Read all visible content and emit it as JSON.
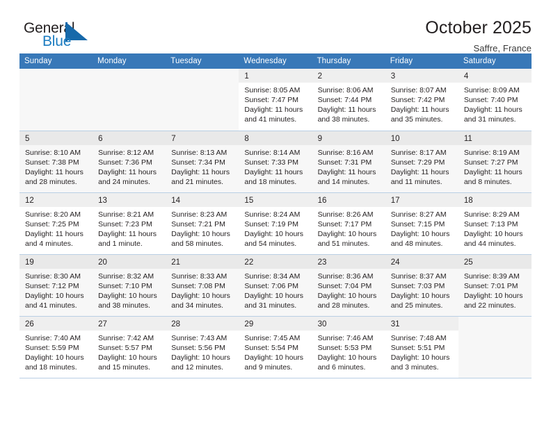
{
  "brand": {
    "name_top": "General",
    "name_bottom": "Blue",
    "logo_icon": "sail-triangle-icon",
    "accent_color": "#1c7cc0"
  },
  "header": {
    "title": "October 2025",
    "location": "Saffre, France"
  },
  "theme": {
    "header_row_bg": "#3878b8",
    "row_border": "#b9cfe4",
    "alt_row_bg": "#f7f7f7",
    "daynum_bg": "#efefef"
  },
  "calendar": {
    "weekday_headers": [
      "Sunday",
      "Monday",
      "Tuesday",
      "Wednesday",
      "Thursday",
      "Friday",
      "Saturday"
    ],
    "labels": {
      "sunrise": "Sunrise:",
      "sunset": "Sunset:",
      "daylight": "Daylight:"
    },
    "weeks": [
      [
        {
          "day": "",
          "empty": true
        },
        {
          "day": "",
          "empty": true
        },
        {
          "day": "",
          "empty": true
        },
        {
          "day": "1",
          "sunrise": "Sunrise: 8:05 AM",
          "sunset": "Sunset: 7:47 PM",
          "daylight": "Daylight: 11 hours and 41 minutes."
        },
        {
          "day": "2",
          "sunrise": "Sunrise: 8:06 AM",
          "sunset": "Sunset: 7:44 PM",
          "daylight": "Daylight: 11 hours and 38 minutes."
        },
        {
          "day": "3",
          "sunrise": "Sunrise: 8:07 AM",
          "sunset": "Sunset: 7:42 PM",
          "daylight": "Daylight: 11 hours and 35 minutes."
        },
        {
          "day": "4",
          "sunrise": "Sunrise: 8:09 AM",
          "sunset": "Sunset: 7:40 PM",
          "daylight": "Daylight: 11 hours and 31 minutes."
        }
      ],
      [
        {
          "day": "5",
          "sunrise": "Sunrise: 8:10 AM",
          "sunset": "Sunset: 7:38 PM",
          "daylight": "Daylight: 11 hours and 28 minutes."
        },
        {
          "day": "6",
          "sunrise": "Sunrise: 8:12 AM",
          "sunset": "Sunset: 7:36 PM",
          "daylight": "Daylight: 11 hours and 24 minutes."
        },
        {
          "day": "7",
          "sunrise": "Sunrise: 8:13 AM",
          "sunset": "Sunset: 7:34 PM",
          "daylight": "Daylight: 11 hours and 21 minutes."
        },
        {
          "day": "8",
          "sunrise": "Sunrise: 8:14 AM",
          "sunset": "Sunset: 7:33 PM",
          "daylight": "Daylight: 11 hours and 18 minutes."
        },
        {
          "day": "9",
          "sunrise": "Sunrise: 8:16 AM",
          "sunset": "Sunset: 7:31 PM",
          "daylight": "Daylight: 11 hours and 14 minutes."
        },
        {
          "day": "10",
          "sunrise": "Sunrise: 8:17 AM",
          "sunset": "Sunset: 7:29 PM",
          "daylight": "Daylight: 11 hours and 11 minutes."
        },
        {
          "day": "11",
          "sunrise": "Sunrise: 8:19 AM",
          "sunset": "Sunset: 7:27 PM",
          "daylight": "Daylight: 11 hours and 8 minutes."
        }
      ],
      [
        {
          "day": "12",
          "sunrise": "Sunrise: 8:20 AM",
          "sunset": "Sunset: 7:25 PM",
          "daylight": "Daylight: 11 hours and 4 minutes."
        },
        {
          "day": "13",
          "sunrise": "Sunrise: 8:21 AM",
          "sunset": "Sunset: 7:23 PM",
          "daylight": "Daylight: 11 hours and 1 minute."
        },
        {
          "day": "14",
          "sunrise": "Sunrise: 8:23 AM",
          "sunset": "Sunset: 7:21 PM",
          "daylight": "Daylight: 10 hours and 58 minutes."
        },
        {
          "day": "15",
          "sunrise": "Sunrise: 8:24 AM",
          "sunset": "Sunset: 7:19 PM",
          "daylight": "Daylight: 10 hours and 54 minutes."
        },
        {
          "day": "16",
          "sunrise": "Sunrise: 8:26 AM",
          "sunset": "Sunset: 7:17 PM",
          "daylight": "Daylight: 10 hours and 51 minutes."
        },
        {
          "day": "17",
          "sunrise": "Sunrise: 8:27 AM",
          "sunset": "Sunset: 7:15 PM",
          "daylight": "Daylight: 10 hours and 48 minutes."
        },
        {
          "day": "18",
          "sunrise": "Sunrise: 8:29 AM",
          "sunset": "Sunset: 7:13 PM",
          "daylight": "Daylight: 10 hours and 44 minutes."
        }
      ],
      [
        {
          "day": "19",
          "sunrise": "Sunrise: 8:30 AM",
          "sunset": "Sunset: 7:12 PM",
          "daylight": "Daylight: 10 hours and 41 minutes."
        },
        {
          "day": "20",
          "sunrise": "Sunrise: 8:32 AM",
          "sunset": "Sunset: 7:10 PM",
          "daylight": "Daylight: 10 hours and 38 minutes."
        },
        {
          "day": "21",
          "sunrise": "Sunrise: 8:33 AM",
          "sunset": "Sunset: 7:08 PM",
          "daylight": "Daylight: 10 hours and 34 minutes."
        },
        {
          "day": "22",
          "sunrise": "Sunrise: 8:34 AM",
          "sunset": "Sunset: 7:06 PM",
          "daylight": "Daylight: 10 hours and 31 minutes."
        },
        {
          "day": "23",
          "sunrise": "Sunrise: 8:36 AM",
          "sunset": "Sunset: 7:04 PM",
          "daylight": "Daylight: 10 hours and 28 minutes."
        },
        {
          "day": "24",
          "sunrise": "Sunrise: 8:37 AM",
          "sunset": "Sunset: 7:03 PM",
          "daylight": "Daylight: 10 hours and 25 minutes."
        },
        {
          "day": "25",
          "sunrise": "Sunrise: 8:39 AM",
          "sunset": "Sunset: 7:01 PM",
          "daylight": "Daylight: 10 hours and 22 minutes."
        }
      ],
      [
        {
          "day": "26",
          "sunrise": "Sunrise: 7:40 AM",
          "sunset": "Sunset: 5:59 PM",
          "daylight": "Daylight: 10 hours and 18 minutes."
        },
        {
          "day": "27",
          "sunrise": "Sunrise: 7:42 AM",
          "sunset": "Sunset: 5:57 PM",
          "daylight": "Daylight: 10 hours and 15 minutes."
        },
        {
          "day": "28",
          "sunrise": "Sunrise: 7:43 AM",
          "sunset": "Sunset: 5:56 PM",
          "daylight": "Daylight: 10 hours and 12 minutes."
        },
        {
          "day": "29",
          "sunrise": "Sunrise: 7:45 AM",
          "sunset": "Sunset: 5:54 PM",
          "daylight": "Daylight: 10 hours and 9 minutes."
        },
        {
          "day": "30",
          "sunrise": "Sunrise: 7:46 AM",
          "sunset": "Sunset: 5:53 PM",
          "daylight": "Daylight: 10 hours and 6 minutes."
        },
        {
          "day": "31",
          "sunrise": "Sunrise: 7:48 AM",
          "sunset": "Sunset: 5:51 PM",
          "daylight": "Daylight: 10 hours and 3 minutes."
        },
        {
          "day": "",
          "empty": true
        }
      ]
    ]
  }
}
